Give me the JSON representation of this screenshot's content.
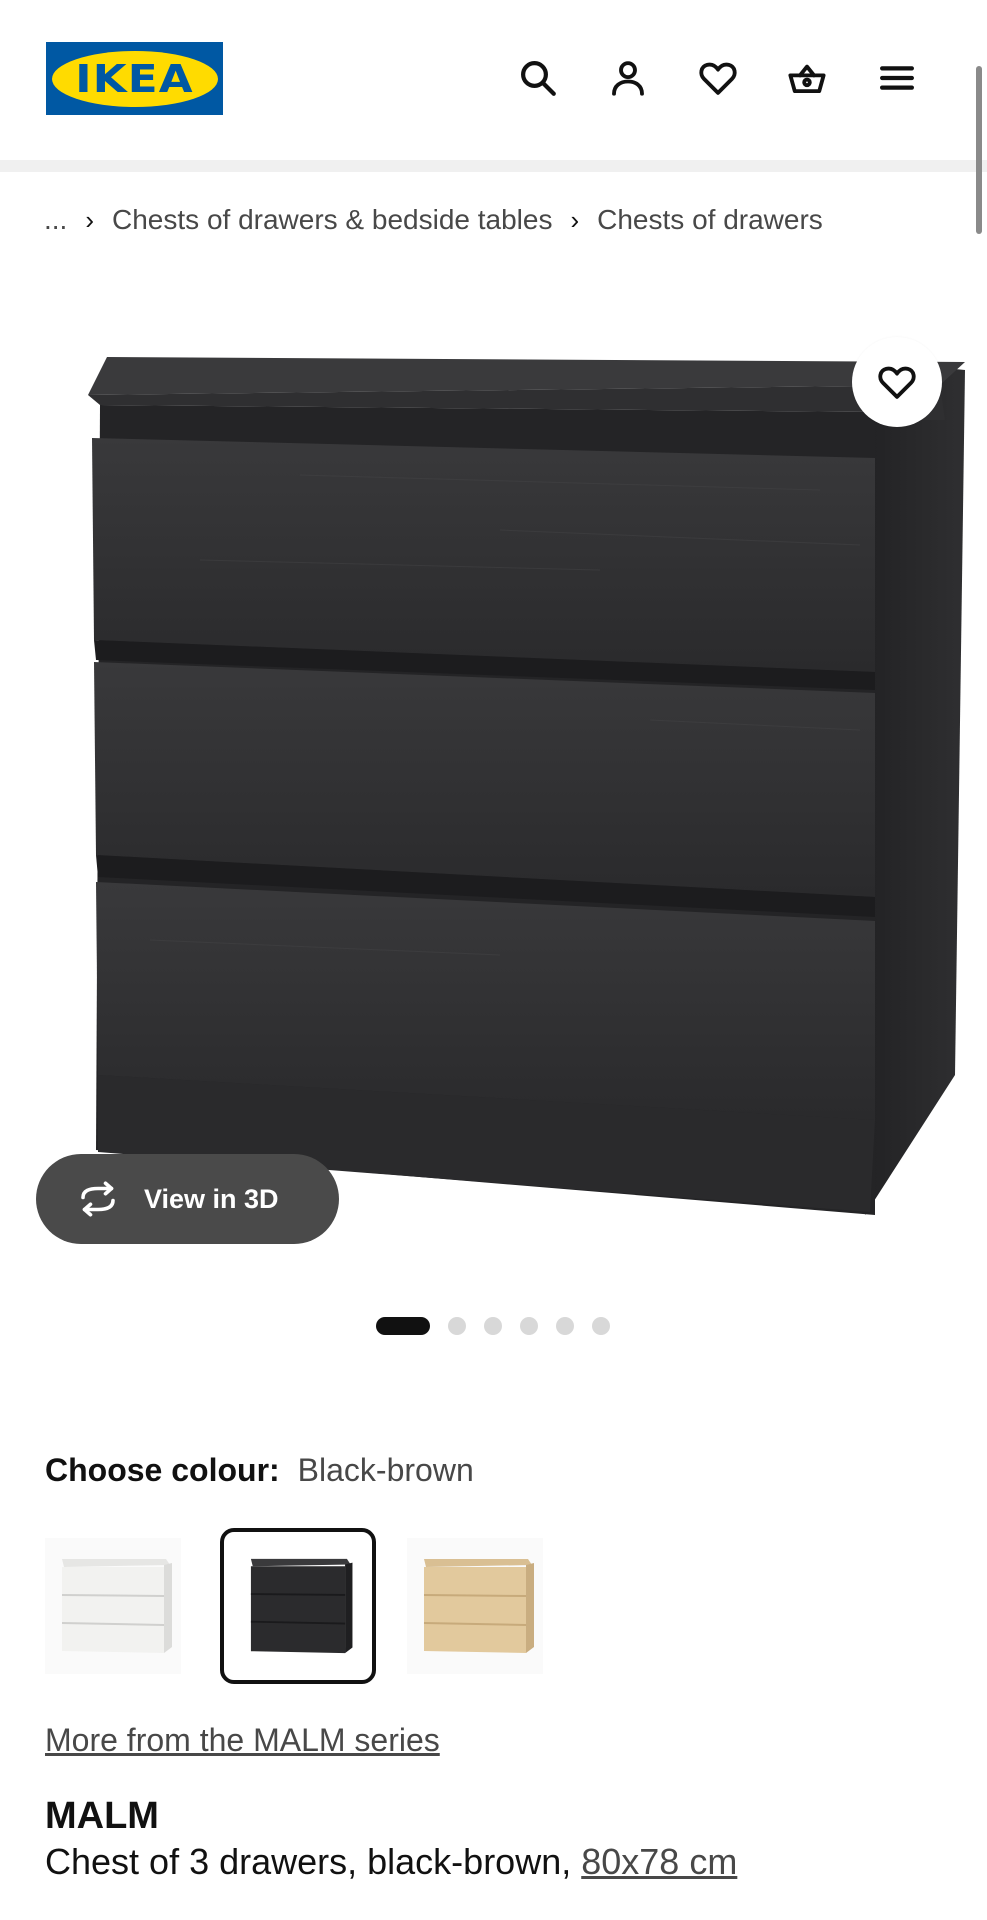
{
  "header": {
    "logo_text": "IKEA",
    "icons": [
      "search-icon",
      "account-icon",
      "heart-icon",
      "basket-icon",
      "menu-icon"
    ]
  },
  "breadcrumb": {
    "ellipsis": "...",
    "items": [
      "Chests of drawers & bedside tables",
      "Chests of drawers"
    ]
  },
  "product_image": {
    "favourite_icon": "heart-icon",
    "view_3d_label": "View in 3D",
    "view_3d_icon": "rotate-icon"
  },
  "carousel": {
    "total": 6,
    "active_index": 0
  },
  "colour": {
    "label": "Choose colour:",
    "selected": "Black-brown",
    "swatches": [
      "white",
      "black-brown",
      "white-stained-oak"
    ],
    "swatch_colors": {
      "white": "#f2f2f0",
      "black-brown": "#2b2b2d",
      "white-stained-oak": "#e2c99d"
    }
  },
  "series_link": "More from the MALM series",
  "product": {
    "name": "MALM",
    "description": "Chest of 3 drawers, black-brown, ",
    "size": "80x78 cm"
  },
  "colors": {
    "ikea_blue": "#0058A3",
    "ikea_yellow": "#FFDB00",
    "text_primary": "#111111",
    "text_secondary": "#484848"
  }
}
